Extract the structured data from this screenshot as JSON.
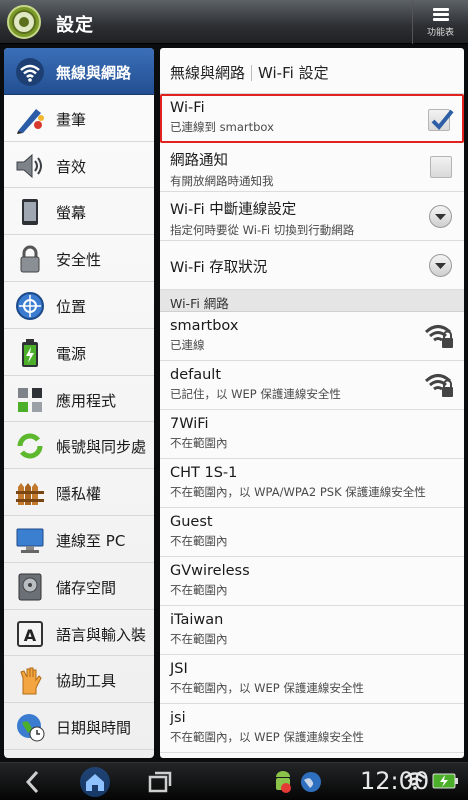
{
  "titlebar": {
    "title": "設定",
    "menu_label": "功能表"
  },
  "sidebar": {
    "items": [
      {
        "label": "無線與網路",
        "icon": "wifi-icon",
        "active": true
      },
      {
        "label": "畫筆",
        "icon": "pen-icon"
      },
      {
        "label": "音效",
        "icon": "speaker-icon"
      },
      {
        "label": "螢幕",
        "icon": "screen-icon"
      },
      {
        "label": "安全性",
        "icon": "lock-icon"
      },
      {
        "label": "位置",
        "icon": "location-icon"
      },
      {
        "label": "電源",
        "icon": "battery-icon"
      },
      {
        "label": "應用程式",
        "icon": "apps-icon"
      },
      {
        "label": "帳號與同步處",
        "icon": "sync-icon"
      },
      {
        "label": "隱私權",
        "icon": "fence-icon"
      },
      {
        "label": "連線至 PC",
        "icon": "pc-icon"
      },
      {
        "label": "儲存空間",
        "icon": "storage-icon"
      },
      {
        "label": "語言與輸入裝",
        "icon": "keyboard-icon"
      },
      {
        "label": "協助工具",
        "icon": "hand-icon"
      },
      {
        "label": "日期與時間",
        "icon": "clock-globe-icon"
      }
    ]
  },
  "content": {
    "breadcrumb": [
      "無線與網路",
      "Wi-Fi 設定"
    ],
    "wifi": {
      "title": "Wi-Fi",
      "subtitle": "已連線到 smartbox",
      "checked": true
    },
    "notify": {
      "title": "網路通知",
      "subtitle": "有開放網路時通知我",
      "checked": false
    },
    "disconnect": {
      "title": "Wi-Fi 中斷連線設定",
      "subtitle": "指定何時要從 Wi-Fi 切換到行動網路"
    },
    "access": {
      "title": "Wi-Fi 存取狀況"
    },
    "section_header": "Wi-Fi 網路",
    "networks": [
      {
        "ssid": "smartbox",
        "status": "已連線",
        "secured_icon": true
      },
      {
        "ssid": "default",
        "status": "已記住，以 WEP 保護連線安全性",
        "secured_icon": true
      },
      {
        "ssid": "7WiFi",
        "status": "不在範圍內"
      },
      {
        "ssid": "CHT 1S-1",
        "status": "不在範圍內，以 WPA/WPA2 PSK 保護連線安全性"
      },
      {
        "ssid": "Guest",
        "status": "不在範圍內"
      },
      {
        "ssid": "GVwireless",
        "status": "不在範圍內"
      },
      {
        "ssid": "iTaiwan",
        "status": "不在範圍內"
      },
      {
        "ssid": "JSI",
        "status": "不在範圍內，以 WEP 保護連線安全性"
      },
      {
        "ssid": "jsi",
        "status": "不在範圍內，以 WEP 保護連線安全性"
      }
    ]
  },
  "statusbar": {
    "time": "12:00"
  },
  "colors": {
    "accent_active": "#2d5ea6",
    "highlight_border": "#e0231e"
  }
}
